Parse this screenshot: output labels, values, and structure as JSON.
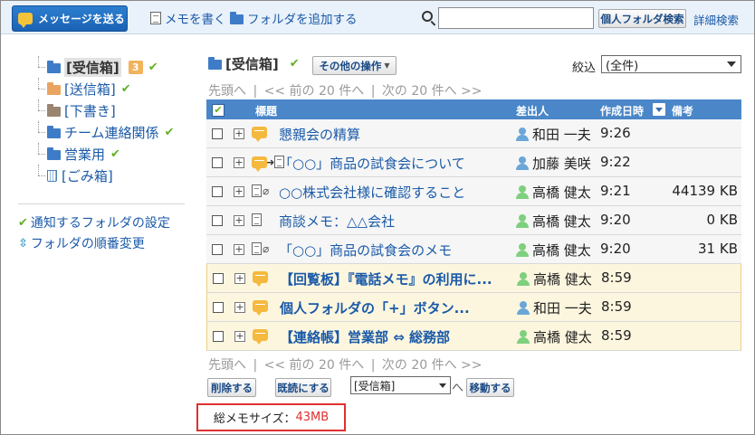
{
  "toolbar": {
    "send_label": "メッセージを送る",
    "write_memo_label": "メモを書く",
    "add_folder_label": "フォルダを追加する",
    "search_value": "",
    "personal_search_label": "個人フォルダ検索",
    "advanced_search_label": "詳細検索"
  },
  "folders": [
    {
      "label": "[受信箱]",
      "icon": "folder-icon",
      "badge": "3",
      "checked": true,
      "selected": true
    },
    {
      "label": "[送信箱]",
      "icon": "folder-orange-icon",
      "checked": true
    },
    {
      "label": "[下書き]",
      "icon": "folder-brown-icon"
    },
    {
      "label": "チーム連絡関係",
      "icon": "folder-icon",
      "checked": true
    },
    {
      "label": "営業用",
      "icon": "folder-icon",
      "checked": true
    },
    {
      "label": "[ごみ箱]",
      "icon": "trash-icon"
    }
  ],
  "left_links": {
    "notify_settings": "通知するフォルダの設定",
    "reorder": "フォルダの順番変更"
  },
  "main": {
    "title": "[受信箱]",
    "other_ops_label": "その他の操作",
    "filter_label": "絞込",
    "filter_value": "(全件)",
    "pager": {
      "first": "先頭へ",
      "sep": "|",
      "prev": "<< 前の 20 件へ",
      "next": "次の 20 件へ >>"
    },
    "columns": {
      "title": "標題",
      "sender": "差出人",
      "created": "作成日時",
      "note": "備考"
    }
  },
  "rows": [
    {
      "icons": "bubble",
      "title": "懇親会の精算",
      "sender": "和田 一夫",
      "sender_type": "blue",
      "time": "9:26",
      "size": "",
      "unread": false
    },
    {
      "icons": "bubble-forward",
      "title": "「○○」商品の試食会について",
      "sender": "加藤 美咲",
      "sender_type": "blue",
      "time": "9:22",
      "size": "",
      "unread": false
    },
    {
      "icons": "memo-clip",
      "title": "○○株式会社様に確認すること",
      "sender": "高橋 健太",
      "sender_type": "green",
      "time": "9:21",
      "size": "44139 KB",
      "unread": false
    },
    {
      "icons": "memo",
      "title": "商談メモ：△△会社",
      "sender": "高橋 健太",
      "sender_type": "green",
      "time": "9:20",
      "size": "0 KB",
      "unread": false
    },
    {
      "icons": "memo-clip",
      "title": "「○○」商品の試食会のメモ",
      "sender": "高橋 健太",
      "sender_type": "green",
      "time": "9:20",
      "size": "31 KB",
      "unread": false
    },
    {
      "icons": "bubble",
      "title": "【回覧板】『電話メモ』の利用に...",
      "sender": "高橋 健太",
      "sender_type": "green",
      "time": "8:59",
      "size": "",
      "unread": true
    },
    {
      "icons": "bubble",
      "title": "個人フォルダの「+」ボタン...",
      "sender": "和田 一夫",
      "sender_type": "blue",
      "time": "8:59",
      "size": "",
      "unread": true
    },
    {
      "icons": "bubble",
      "title": "【連絡帳】営業部 ⇔ 総務部",
      "sender": "高橋 健太",
      "sender_type": "green",
      "time": "8:59",
      "size": "",
      "unread": true
    }
  ],
  "actions": {
    "delete_label": "削除する",
    "mark_read_label": "既読にする",
    "move_target_value": "[受信箱]",
    "to_label": "へ",
    "move_label": "移動する"
  },
  "footer": {
    "total_label": "総メモサイズ：",
    "total_value": "43MB"
  }
}
